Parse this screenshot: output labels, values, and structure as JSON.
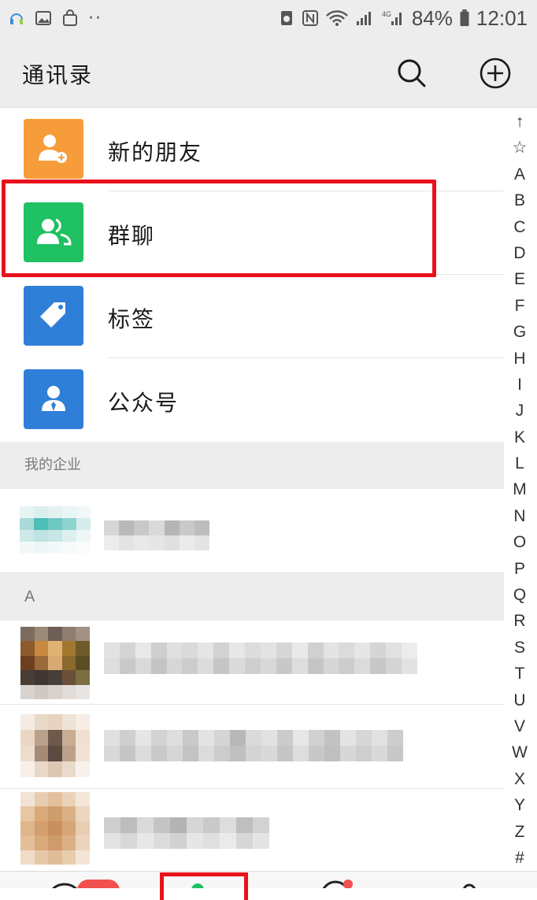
{
  "status_bar": {
    "battery_percent": "84%",
    "time": "12:01",
    "overflow_dots": "··"
  },
  "header": {
    "title": "通讯录",
    "search_icon": "search-icon",
    "add_icon": "add-circle-icon"
  },
  "function_items": [
    {
      "label": "新的朋友",
      "icon": "add-friend-icon",
      "color": "#f79c3a"
    },
    {
      "label": "群聊",
      "icon": "group-chat-icon",
      "color": "#1fc162"
    },
    {
      "label": "标签",
      "icon": "tag-icon",
      "color": "#2f7fd8"
    },
    {
      "label": "公众号",
      "icon": "official-account-icon",
      "color": "#2f7fd8"
    }
  ],
  "sections": {
    "enterprise": "我的企业",
    "letter_a": "A"
  },
  "index_letters": [
    "↑",
    "☆",
    "A",
    "B",
    "C",
    "D",
    "E",
    "F",
    "G",
    "H",
    "I",
    "J",
    "K",
    "L",
    "M",
    "N",
    "O",
    "P",
    "Q",
    "R",
    "S",
    "T",
    "U",
    "V",
    "W",
    "X",
    "Y",
    "Z",
    "#"
  ],
  "colors": {
    "highlight": "#e8121c",
    "wechat_green": "#1fc162",
    "header_bg": "#ededed"
  }
}
